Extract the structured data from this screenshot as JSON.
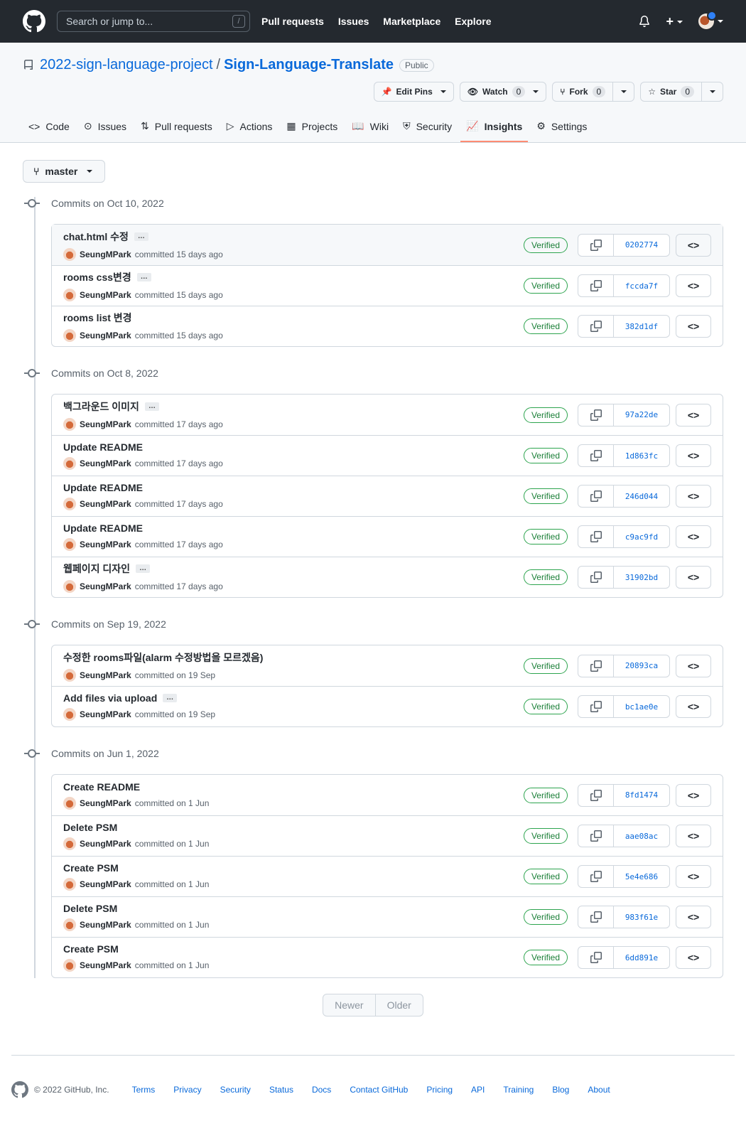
{
  "topbar": {
    "search_placeholder": "Search or jump to...",
    "slash": "/",
    "nav": [
      "Pull requests",
      "Issues",
      "Marketplace",
      "Explore"
    ]
  },
  "repo": {
    "owner": "2022-sign-language-project",
    "separator": "/",
    "name": "Sign-Language-Translate",
    "visibility": "Public",
    "edit_pins": "Edit Pins",
    "watch": {
      "label": "Watch",
      "count": "0"
    },
    "fork": {
      "label": "Fork",
      "count": "0"
    },
    "star": {
      "label": "Star",
      "count": "0"
    }
  },
  "tabs": [
    "Code",
    "Issues",
    "Pull requests",
    "Actions",
    "Projects",
    "Wiki",
    "Security",
    "Insights",
    "Settings"
  ],
  "branch": "master",
  "verified_label": "Verified",
  "groups": [
    {
      "heading": "Commits on Oct 10, 2022",
      "commits": [
        {
          "title": "chat.html 수정",
          "ellipsis": true,
          "author": "SeungMPark",
          "when": "committed 15 days ago",
          "sha": "0202774"
        },
        {
          "title": "rooms css변경",
          "ellipsis": true,
          "author": "SeungMPark",
          "when": "committed 15 days ago",
          "sha": "fccda7f"
        },
        {
          "title": "rooms list 변경",
          "ellipsis": false,
          "author": "SeungMPark",
          "when": "committed 15 days ago",
          "sha": "382d1df"
        }
      ]
    },
    {
      "heading": "Commits on Oct 8, 2022",
      "commits": [
        {
          "title": "백그라운드 이미지",
          "ellipsis": true,
          "author": "SeungMPark",
          "when": "committed 17 days ago",
          "sha": "97a22de"
        },
        {
          "title": "Update README",
          "ellipsis": false,
          "author": "SeungMPark",
          "when": "committed 17 days ago",
          "sha": "1d863fc"
        },
        {
          "title": "Update README",
          "ellipsis": false,
          "author": "SeungMPark",
          "when": "committed 17 days ago",
          "sha": "246d044"
        },
        {
          "title": "Update README",
          "ellipsis": false,
          "author": "SeungMPark",
          "when": "committed 17 days ago",
          "sha": "c9ac9fd"
        },
        {
          "title": "웹페이지 디자인",
          "ellipsis": true,
          "author": "SeungMPark",
          "when": "committed 17 days ago",
          "sha": "31902bd"
        }
      ]
    },
    {
      "heading": "Commits on Sep 19, 2022",
      "commits": [
        {
          "title": "수정한 rooms파일(alarm 수정방법을 모르겠음)",
          "ellipsis": false,
          "author": "SeungMPark",
          "when": "committed on 19 Sep",
          "sha": "20893ca"
        },
        {
          "title": "Add files via upload",
          "ellipsis": true,
          "author": "SeungMPark",
          "when": "committed on 19 Sep",
          "sha": "bc1ae0e"
        }
      ]
    },
    {
      "heading": "Commits on Jun 1, 2022",
      "commits": [
        {
          "title": "Create README",
          "ellipsis": false,
          "author": "SeungMPark",
          "when": "committed on 1 Jun",
          "sha": "8fd1474"
        },
        {
          "title": "Delete PSM",
          "ellipsis": false,
          "author": "SeungMPark",
          "when": "committed on 1 Jun",
          "sha": "aae08ac"
        },
        {
          "title": "Create PSM",
          "ellipsis": false,
          "author": "SeungMPark",
          "when": "committed on 1 Jun",
          "sha": "5e4e686"
        },
        {
          "title": "Delete PSM",
          "ellipsis": false,
          "author": "SeungMPark",
          "when": "committed on 1 Jun",
          "sha": "983f61e"
        },
        {
          "title": "Create PSM",
          "ellipsis": false,
          "author": "SeungMPark",
          "when": "committed on 1 Jun",
          "sha": "6dd891e"
        }
      ]
    }
  ],
  "pager": {
    "newer": "Newer",
    "older": "Older"
  },
  "footer": {
    "copyright": "© 2022 GitHub, Inc.",
    "links": [
      "Terms",
      "Privacy",
      "Security",
      "Status",
      "Docs",
      "Contact GitHub",
      "Pricing",
      "API",
      "Training",
      "Blog",
      "About"
    ]
  }
}
